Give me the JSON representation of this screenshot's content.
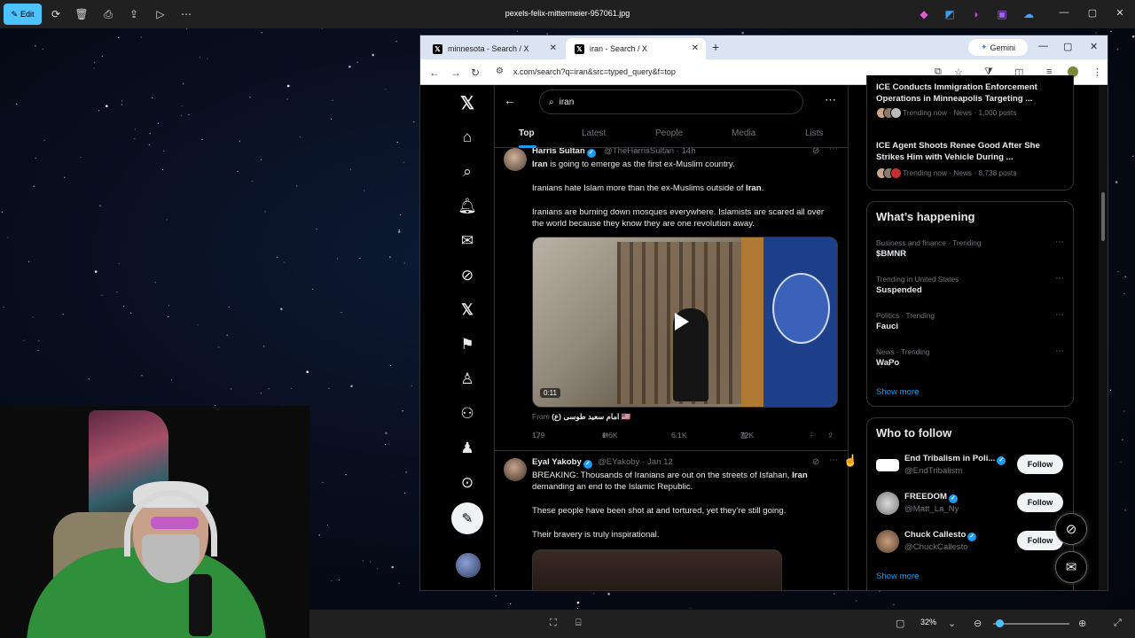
{
  "viewer": {
    "edit_label": "Edit",
    "filename": "pexels-felix-mittermeier-957061.jpg",
    "zoom": "32%"
  },
  "browser": {
    "tabs": [
      {
        "label": "minnesota - Search / X",
        "active": false
      },
      {
        "label": "iran - Search / X",
        "active": true
      }
    ],
    "gemini_label": "Gemini",
    "url": "x.com/search?q=iran&src=typed_query&f=top"
  },
  "search": {
    "query": "iran",
    "tabs": [
      "Top",
      "Latest",
      "People",
      "Media",
      "Lists"
    ]
  },
  "tweets": [
    {
      "name": "Harris Sultan",
      "handle": "@TheHarrisSultan",
      "time": "14h",
      "lines": [
        "Iran is going to emerge as the first ex-Muslim country.",
        "Iranians hate Islam more than the ex-Muslims outside of Iran.",
        "Iranians are burning down mosques everywhere. Islamists are scared all over the world because they know they are one revolution away."
      ],
      "video_duration": "0:11",
      "from_label": "From",
      "from_source": "امام سعيد طوسى (ع) 🇺🇸",
      "replies": "179",
      "reposts": "1.6K",
      "likes": "6.1K",
      "views": "72K"
    },
    {
      "name": "Eyal Yakoby",
      "handle": "@EYakoby",
      "time": "Jan 12",
      "lines": [
        "BREAKING: Thousands of Iranians are out on the streets of Isfahan, Iran demanding an end to the Islamic Republic.",
        "These people have been shot at and tortured, yet they’re still going.",
        "Their bravery is truly inspirational."
      ]
    }
  ],
  "news": [
    {
      "title": "ICE Conducts Immigration Enforcement Operations in Minneapolis Targeting ...",
      "meta": "Trending now · News · 1,000 posts"
    },
    {
      "title": "ICE Agent Shoots Renee Good After She Strikes Him with Vehicle During ...",
      "meta": "Trending now · News · 8,738 posts"
    }
  ],
  "whats_happening": {
    "title": "What’s happening",
    "trends": [
      {
        "context": "Business and finance · Trending",
        "name": "$BMNR"
      },
      {
        "context": "Trending in United States",
        "name": "Suspended"
      },
      {
        "context": "Politics · Trending",
        "name": "Fauci"
      },
      {
        "context": "News · Trending",
        "name": "WaPo"
      }
    ],
    "show_more": "Show more"
  },
  "who_to_follow": {
    "title": "Who to follow",
    "accounts": [
      {
        "name": "End Tribalism in Poli...",
        "handle": "@EndTribalism"
      },
      {
        "name": "FREEDOM",
        "handle": "@Matt_La_Ny"
      },
      {
        "name": "Chuck Callesto",
        "handle": "@ChuckCallesto"
      }
    ],
    "follow_label": "Follow",
    "show_more": "Show more"
  },
  "colors": {
    "accent": "#1d9bf0",
    "viewer_edit": "#4cc2ff",
    "background": "#000000"
  }
}
